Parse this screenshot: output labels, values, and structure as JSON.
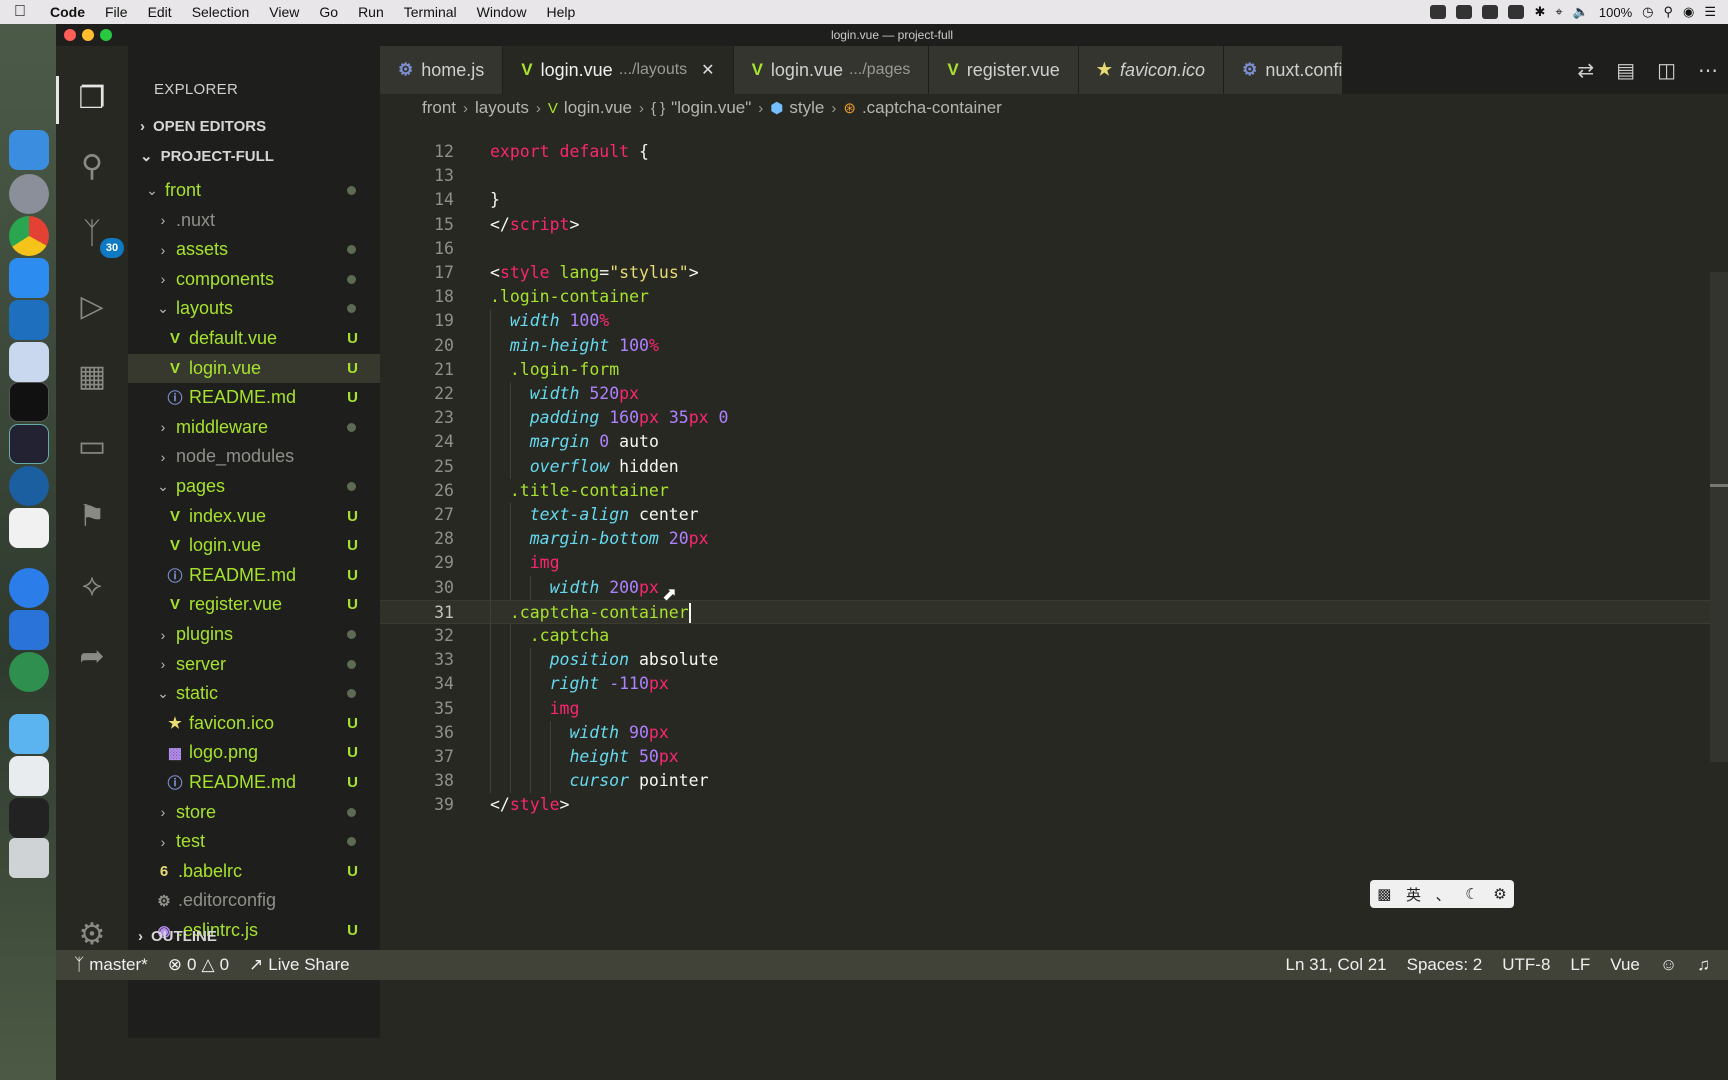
{
  "menubar": {
    "app": "Code",
    "items": [
      "File",
      "Edit",
      "Selection",
      "View",
      "Go",
      "Run",
      "Terminal",
      "Window",
      "Help"
    ],
    "battery": "100%"
  },
  "window": {
    "title": "login.vue — project-full"
  },
  "activity": {
    "scm_badge": "30"
  },
  "sidebar": {
    "title": "EXPLORER",
    "open_editors": "OPEN EDITORS",
    "project": "PROJECT-FULL",
    "outline": "OUTLINE",
    "tree": [
      {
        "label": "front",
        "indent": 1,
        "type": "folder-open",
        "status": "dot",
        "color": "green"
      },
      {
        "label": ".nuxt",
        "indent": 2,
        "type": "folder",
        "status": "",
        "color": "dim"
      },
      {
        "label": "assets",
        "indent": 2,
        "type": "folder",
        "status": "dot",
        "color": "green"
      },
      {
        "label": "components",
        "indent": 2,
        "type": "folder",
        "status": "dot",
        "color": "green"
      },
      {
        "label": "layouts",
        "indent": 2,
        "type": "folder-open",
        "status": "dot",
        "color": "green"
      },
      {
        "label": "default.vue",
        "indent": 3,
        "type": "vue",
        "status": "U",
        "color": "green"
      },
      {
        "label": "login.vue",
        "indent": 3,
        "type": "vue",
        "status": "U",
        "color": "green",
        "selected": true
      },
      {
        "label": "README.md",
        "indent": 3,
        "type": "info",
        "status": "U",
        "color": "green"
      },
      {
        "label": "middleware",
        "indent": 2,
        "type": "folder",
        "status": "dot",
        "color": "green"
      },
      {
        "label": "node_modules",
        "indent": 2,
        "type": "folder",
        "status": "",
        "color": "dim"
      },
      {
        "label": "pages",
        "indent": 2,
        "type": "folder-open",
        "status": "dot",
        "color": "green"
      },
      {
        "label": "index.vue",
        "indent": 3,
        "type": "vue",
        "status": "U",
        "color": "green"
      },
      {
        "label": "login.vue",
        "indent": 3,
        "type": "vue",
        "status": "U",
        "color": "green"
      },
      {
        "label": "README.md",
        "indent": 3,
        "type": "info",
        "status": "U",
        "color": "green"
      },
      {
        "label": "register.vue",
        "indent": 3,
        "type": "vue",
        "status": "U",
        "color": "green"
      },
      {
        "label": "plugins",
        "indent": 2,
        "type": "folder",
        "status": "dot",
        "color": "green"
      },
      {
        "label": "server",
        "indent": 2,
        "type": "folder",
        "status": "dot",
        "color": "green"
      },
      {
        "label": "static",
        "indent": 2,
        "type": "folder-open",
        "status": "dot",
        "color": "green"
      },
      {
        "label": "favicon.ico",
        "indent": 3,
        "type": "star",
        "status": "U",
        "color": "green"
      },
      {
        "label": "logo.png",
        "indent": 3,
        "type": "image",
        "status": "U",
        "color": "green"
      },
      {
        "label": "README.md",
        "indent": 3,
        "type": "info",
        "status": "U",
        "color": "green"
      },
      {
        "label": "store",
        "indent": 2,
        "type": "folder",
        "status": "dot",
        "color": "green"
      },
      {
        "label": "test",
        "indent": 2,
        "type": "folder",
        "status": "dot",
        "color": "green"
      },
      {
        "label": ".babelrc",
        "indent": 2,
        "type": "babel",
        "status": "U",
        "color": "green"
      },
      {
        "label": ".editorconfig",
        "indent": 2,
        "type": "gear",
        "status": "",
        "color": "dim"
      },
      {
        "label": ".eslintrc.js",
        "indent": 2,
        "type": "eslint",
        "status": "U",
        "color": "green"
      }
    ]
  },
  "tabs": [
    {
      "label": "home.js",
      "desc": "",
      "icon": "gear-icon",
      "active": false,
      "italic": false
    },
    {
      "label": "login.vue",
      "desc": ".../layouts",
      "icon": "vue-icon",
      "active": true,
      "italic": false
    },
    {
      "label": "login.vue",
      "desc": ".../pages",
      "icon": "vue-icon",
      "active": false,
      "italic": false
    },
    {
      "label": "register.vue",
      "desc": "",
      "icon": "vue-icon",
      "active": false,
      "italic": false
    },
    {
      "label": "favicon.ico",
      "desc": "",
      "icon": "star-icon",
      "active": false,
      "italic": true
    },
    {
      "label": "nuxt.confi",
      "desc": "",
      "icon": "gear-icon",
      "active": false,
      "italic": false
    }
  ],
  "breadcrumb": [
    "front",
    "layouts",
    "login.vue",
    "\"login.vue\"",
    "style",
    ".captcha-container"
  ],
  "editor": {
    "current_line": 31,
    "lines": [
      {
        "n": "12",
        "indent": 0,
        "tokens": [
          [
            "kw",
            "export default"
          ],
          [
            "plain",
            " {"
          ]
        ]
      },
      {
        "n": "13",
        "indent": 0,
        "tokens": []
      },
      {
        "n": "14",
        "indent": 0,
        "tokens": [
          [
            "plain",
            "}"
          ]
        ]
      },
      {
        "n": "15",
        "indent": 0,
        "tokens": [
          [
            "plain",
            "</"
          ],
          [
            "tag",
            "script"
          ],
          [
            "plain",
            ">"
          ]
        ]
      },
      {
        "n": "16",
        "indent": 0,
        "tokens": []
      },
      {
        "n": "17",
        "indent": 0,
        "tokens": [
          [
            "plain",
            "<"
          ],
          [
            "tag",
            "style"
          ],
          [
            "plain",
            " "
          ],
          [
            "attr",
            "lang"
          ],
          [
            "plain",
            "="
          ],
          [
            "str",
            "\"stylus\""
          ],
          [
            "plain",
            ">"
          ]
        ]
      },
      {
        "n": "18",
        "indent": 0,
        "tokens": [
          [
            "sel",
            ".login-container"
          ]
        ]
      },
      {
        "n": "19",
        "indent": 1,
        "tokens": [
          [
            "prop",
            "width"
          ],
          [
            "plain",
            " "
          ],
          [
            "num",
            "100"
          ],
          [
            "unit",
            "%"
          ]
        ]
      },
      {
        "n": "20",
        "indent": 1,
        "tokens": [
          [
            "prop",
            "min-height"
          ],
          [
            "plain",
            " "
          ],
          [
            "num",
            "100"
          ],
          [
            "unit",
            "%"
          ]
        ]
      },
      {
        "n": "21",
        "indent": 1,
        "tokens": [
          [
            "sel",
            ".login-form"
          ]
        ]
      },
      {
        "n": "22",
        "indent": 2,
        "tokens": [
          [
            "prop",
            "width"
          ],
          [
            "plain",
            " "
          ],
          [
            "num",
            "520"
          ],
          [
            "unit",
            "px"
          ]
        ]
      },
      {
        "n": "23",
        "indent": 2,
        "tokens": [
          [
            "prop",
            "padding"
          ],
          [
            "plain",
            " "
          ],
          [
            "num",
            "160"
          ],
          [
            "unit",
            "px"
          ],
          [
            "plain",
            " "
          ],
          [
            "num",
            "35"
          ],
          [
            "unit",
            "px"
          ],
          [
            "plain",
            " "
          ],
          [
            "num",
            "0"
          ]
        ]
      },
      {
        "n": "24",
        "indent": 2,
        "tokens": [
          [
            "prop",
            "margin"
          ],
          [
            "plain",
            " "
          ],
          [
            "num",
            "0"
          ],
          [
            "plain",
            " auto"
          ]
        ]
      },
      {
        "n": "25",
        "indent": 2,
        "tokens": [
          [
            "prop",
            "overflow"
          ],
          [
            "plain",
            " hidden"
          ]
        ]
      },
      {
        "n": "26",
        "indent": 1,
        "tokens": [
          [
            "sel",
            ".title-container"
          ]
        ]
      },
      {
        "n": "27",
        "indent": 2,
        "tokens": [
          [
            "prop",
            "text-align"
          ],
          [
            "plain",
            " center"
          ]
        ]
      },
      {
        "n": "28",
        "indent": 2,
        "tokens": [
          [
            "prop",
            "margin-bottom"
          ],
          [
            "plain",
            " "
          ],
          [
            "num",
            "20"
          ],
          [
            "unit",
            "px"
          ]
        ]
      },
      {
        "n": "29",
        "indent": 2,
        "tokens": [
          [
            "tag",
            "img"
          ]
        ]
      },
      {
        "n": "30",
        "indent": 3,
        "tokens": [
          [
            "prop",
            "width"
          ],
          [
            "plain",
            " "
          ],
          [
            "num",
            "200"
          ],
          [
            "unit",
            "px"
          ]
        ]
      },
      {
        "n": "31",
        "indent": 1,
        "tokens": [
          [
            "sel",
            ".captcha-container"
          ]
        ],
        "cursor": true
      },
      {
        "n": "32",
        "indent": 2,
        "tokens": [
          [
            "sel",
            ".captcha"
          ]
        ]
      },
      {
        "n": "33",
        "indent": 3,
        "tokens": [
          [
            "prop",
            "position"
          ],
          [
            "plain",
            " absolute"
          ]
        ]
      },
      {
        "n": "34",
        "indent": 3,
        "tokens": [
          [
            "prop",
            "right"
          ],
          [
            "plain",
            " "
          ],
          [
            "num",
            "-110"
          ],
          [
            "unit",
            "px"
          ]
        ]
      },
      {
        "n": "35",
        "indent": 3,
        "tokens": [
          [
            "tag",
            "img"
          ]
        ]
      },
      {
        "n": "36",
        "indent": 4,
        "tokens": [
          [
            "prop",
            "width"
          ],
          [
            "plain",
            " "
          ],
          [
            "num",
            "90"
          ],
          [
            "unit",
            "px"
          ]
        ]
      },
      {
        "n": "37",
        "indent": 4,
        "tokens": [
          [
            "prop",
            "height"
          ],
          [
            "plain",
            " "
          ],
          [
            "num",
            "50"
          ],
          [
            "unit",
            "px"
          ]
        ]
      },
      {
        "n": "38",
        "indent": 4,
        "tokens": [
          [
            "prop",
            "cursor"
          ],
          [
            "plain",
            " pointer"
          ]
        ]
      },
      {
        "n": "39",
        "indent": 0,
        "tokens": [
          [
            "plain",
            "</"
          ],
          [
            "tag",
            "style"
          ],
          [
            "plain",
            ">"
          ]
        ]
      }
    ]
  },
  "ime": {
    "lang": "英",
    "punct": "、"
  },
  "statusbar": {
    "branch": "master*",
    "errors": "0",
    "warnings": "0",
    "live_share": "Live Share",
    "position": "Ln 31, Col 21",
    "spaces": "Spaces: 2",
    "encoding": "UTF-8",
    "eol": "LF",
    "language": "Vue"
  },
  "colors": {
    "accent": "#a6e22e",
    "keyword": "#f92672",
    "property": "#66d9ef",
    "number": "#ae81ff",
    "badge": "#0e7ac4"
  }
}
